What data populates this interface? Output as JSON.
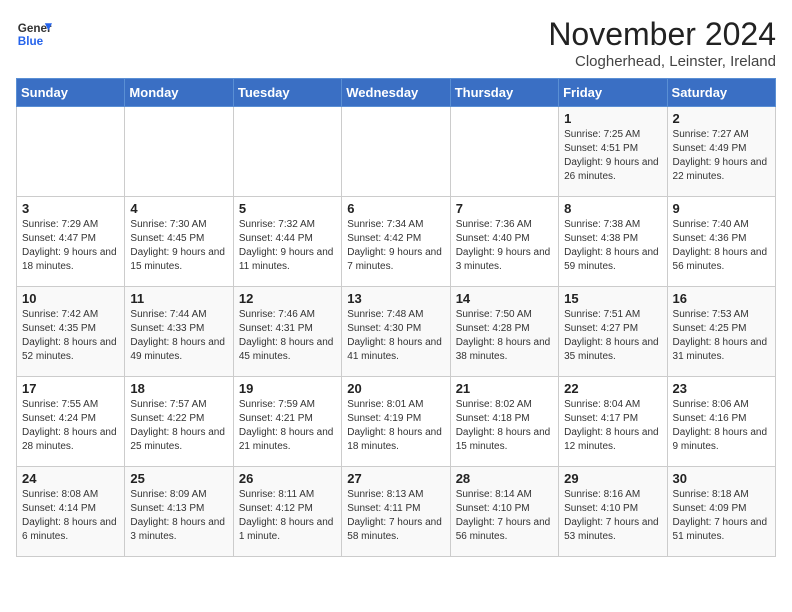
{
  "header": {
    "logo_line1": "General",
    "logo_line2": "Blue",
    "month": "November 2024",
    "location": "Clogherhead, Leinster, Ireland"
  },
  "days_of_week": [
    "Sunday",
    "Monday",
    "Tuesday",
    "Wednesday",
    "Thursday",
    "Friday",
    "Saturday"
  ],
  "weeks": [
    [
      {
        "day": "",
        "info": ""
      },
      {
        "day": "",
        "info": ""
      },
      {
        "day": "",
        "info": ""
      },
      {
        "day": "",
        "info": ""
      },
      {
        "day": "",
        "info": ""
      },
      {
        "day": "1",
        "info": "Sunrise: 7:25 AM\nSunset: 4:51 PM\nDaylight: 9 hours and 26 minutes."
      },
      {
        "day": "2",
        "info": "Sunrise: 7:27 AM\nSunset: 4:49 PM\nDaylight: 9 hours and 22 minutes."
      }
    ],
    [
      {
        "day": "3",
        "info": "Sunrise: 7:29 AM\nSunset: 4:47 PM\nDaylight: 9 hours and 18 minutes."
      },
      {
        "day": "4",
        "info": "Sunrise: 7:30 AM\nSunset: 4:45 PM\nDaylight: 9 hours and 15 minutes."
      },
      {
        "day": "5",
        "info": "Sunrise: 7:32 AM\nSunset: 4:44 PM\nDaylight: 9 hours and 11 minutes."
      },
      {
        "day": "6",
        "info": "Sunrise: 7:34 AM\nSunset: 4:42 PM\nDaylight: 9 hours and 7 minutes."
      },
      {
        "day": "7",
        "info": "Sunrise: 7:36 AM\nSunset: 4:40 PM\nDaylight: 9 hours and 3 minutes."
      },
      {
        "day": "8",
        "info": "Sunrise: 7:38 AM\nSunset: 4:38 PM\nDaylight: 8 hours and 59 minutes."
      },
      {
        "day": "9",
        "info": "Sunrise: 7:40 AM\nSunset: 4:36 PM\nDaylight: 8 hours and 56 minutes."
      }
    ],
    [
      {
        "day": "10",
        "info": "Sunrise: 7:42 AM\nSunset: 4:35 PM\nDaylight: 8 hours and 52 minutes."
      },
      {
        "day": "11",
        "info": "Sunrise: 7:44 AM\nSunset: 4:33 PM\nDaylight: 8 hours and 49 minutes."
      },
      {
        "day": "12",
        "info": "Sunrise: 7:46 AM\nSunset: 4:31 PM\nDaylight: 8 hours and 45 minutes."
      },
      {
        "day": "13",
        "info": "Sunrise: 7:48 AM\nSunset: 4:30 PM\nDaylight: 8 hours and 41 minutes."
      },
      {
        "day": "14",
        "info": "Sunrise: 7:50 AM\nSunset: 4:28 PM\nDaylight: 8 hours and 38 minutes."
      },
      {
        "day": "15",
        "info": "Sunrise: 7:51 AM\nSunset: 4:27 PM\nDaylight: 8 hours and 35 minutes."
      },
      {
        "day": "16",
        "info": "Sunrise: 7:53 AM\nSunset: 4:25 PM\nDaylight: 8 hours and 31 minutes."
      }
    ],
    [
      {
        "day": "17",
        "info": "Sunrise: 7:55 AM\nSunset: 4:24 PM\nDaylight: 8 hours and 28 minutes."
      },
      {
        "day": "18",
        "info": "Sunrise: 7:57 AM\nSunset: 4:22 PM\nDaylight: 8 hours and 25 minutes."
      },
      {
        "day": "19",
        "info": "Sunrise: 7:59 AM\nSunset: 4:21 PM\nDaylight: 8 hours and 21 minutes."
      },
      {
        "day": "20",
        "info": "Sunrise: 8:01 AM\nSunset: 4:19 PM\nDaylight: 8 hours and 18 minutes."
      },
      {
        "day": "21",
        "info": "Sunrise: 8:02 AM\nSunset: 4:18 PM\nDaylight: 8 hours and 15 minutes."
      },
      {
        "day": "22",
        "info": "Sunrise: 8:04 AM\nSunset: 4:17 PM\nDaylight: 8 hours and 12 minutes."
      },
      {
        "day": "23",
        "info": "Sunrise: 8:06 AM\nSunset: 4:16 PM\nDaylight: 8 hours and 9 minutes."
      }
    ],
    [
      {
        "day": "24",
        "info": "Sunrise: 8:08 AM\nSunset: 4:14 PM\nDaylight: 8 hours and 6 minutes."
      },
      {
        "day": "25",
        "info": "Sunrise: 8:09 AM\nSunset: 4:13 PM\nDaylight: 8 hours and 3 minutes."
      },
      {
        "day": "26",
        "info": "Sunrise: 8:11 AM\nSunset: 4:12 PM\nDaylight: 8 hours and 1 minute."
      },
      {
        "day": "27",
        "info": "Sunrise: 8:13 AM\nSunset: 4:11 PM\nDaylight: 7 hours and 58 minutes."
      },
      {
        "day": "28",
        "info": "Sunrise: 8:14 AM\nSunset: 4:10 PM\nDaylight: 7 hours and 56 minutes."
      },
      {
        "day": "29",
        "info": "Sunrise: 8:16 AM\nSunset: 4:10 PM\nDaylight: 7 hours and 53 minutes."
      },
      {
        "day": "30",
        "info": "Sunrise: 8:18 AM\nSunset: 4:09 PM\nDaylight: 7 hours and 51 minutes."
      }
    ]
  ]
}
